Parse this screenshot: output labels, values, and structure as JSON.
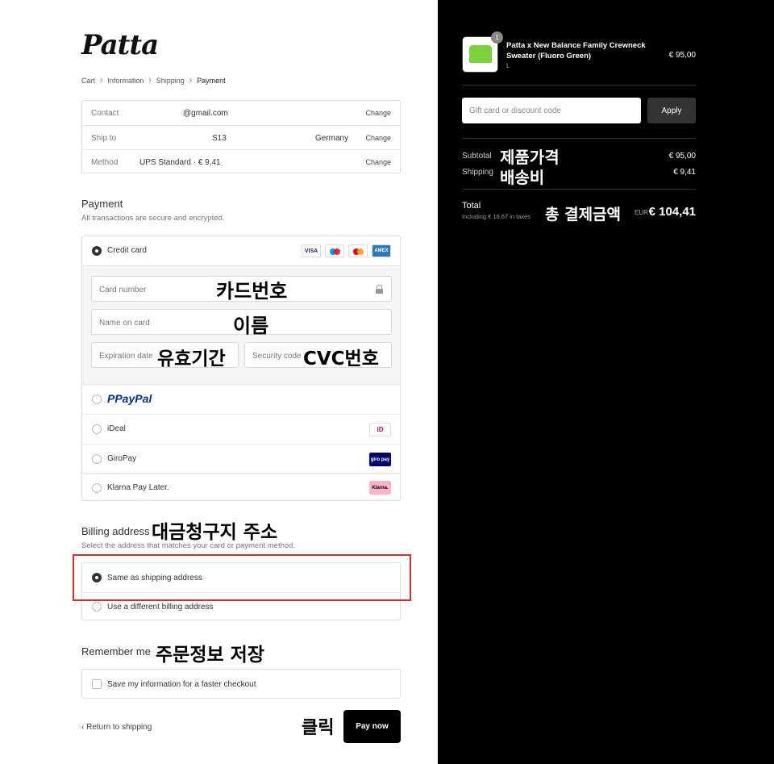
{
  "brand": {
    "logo_text": "Patta"
  },
  "breadcrumb": [
    {
      "label": "Cart"
    },
    {
      "label": "Information"
    },
    {
      "label": "Shipping"
    },
    {
      "label": "Payment"
    }
  ],
  "review": {
    "contact": {
      "label": "Contact",
      "value": "@gmail.com",
      "action": "Change"
    },
    "ship_to": {
      "label": "Ship to",
      "value": "S13",
      "country": "Germany",
      "action": "Change"
    },
    "method": {
      "label": "Method",
      "value": "UPS Standard · € 9,41",
      "action": "Change"
    }
  },
  "payment": {
    "title": "Payment",
    "subtitle": "All transactions are secure and encrypted.",
    "credit_card_label": "Credit card",
    "card_icons": [
      "VISA",
      "maestro",
      "mastercard",
      "AMEX"
    ],
    "card_number_placeholder": "Card number",
    "name_placeholder": "Name on card",
    "expiry_placeholder": "Expiration date",
    "security_placeholder": "Security code",
    "paypal_label": "PayPal",
    "ideal_label": "iDeal",
    "giropay_label": "GiroPay",
    "klarna_label": "Klarna Pay Later.",
    "klarna_logo": "Klarna.",
    "giropay_logo": "giro pay",
    "ideal_logo": "iD"
  },
  "annotations": {
    "card_number": "카드번호",
    "name": "이름",
    "expiry": "유효기간",
    "cvc": "CVC번호",
    "billing": "대금청구지 주소",
    "remember": "주문정보 저장",
    "click": "클릭",
    "subtotal": "제품가격",
    "shipping": "배송비",
    "total": "총 결제금액"
  },
  "billing": {
    "title": "Billing address",
    "subtitle": "Select the address that matches your card or payment method.",
    "same_label": "Same as shipping address",
    "different_label": "Use a different billing address"
  },
  "remember": {
    "title": "Remember me",
    "checkbox_label": "Save my information for a faster checkout"
  },
  "footer": {
    "back_label": "Return to shipping",
    "pay_label": "Pay now"
  },
  "order": {
    "quantity_badge": "1",
    "product_name": "Patta x New Balance Family Crewneck Sweater (Fluoro Green)",
    "variant": "L",
    "price": "€ 95,00",
    "gift_placeholder": "Gift card or discount code",
    "apply_label": "Apply",
    "subtotal_label": "Subtotal",
    "subtotal_value": "€ 95,00",
    "shipping_label": "Shipping",
    "shipping_value": "€ 9,41",
    "total_label": "Total",
    "taxes_note": "Including € 16,67 in taxes",
    "currency": "EUR",
    "total_value": "€ 104,41"
  },
  "colors": {
    "accent": "#000000",
    "product_green": "#7bd23b",
    "highlight_red": "#d32f2f"
  }
}
